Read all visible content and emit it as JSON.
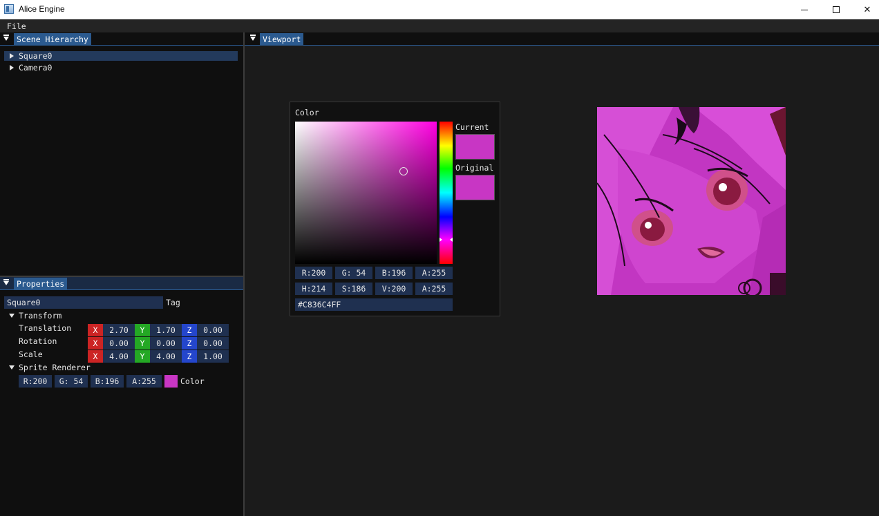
{
  "window": {
    "title": "Alice Engine"
  },
  "menu": {
    "file": "File"
  },
  "hierarchy": {
    "tab": "Scene Hierarchy",
    "items": [
      {
        "label": "Square0",
        "selected": true
      },
      {
        "label": "Camera0",
        "selected": false
      }
    ]
  },
  "properties": {
    "tab": "Properties",
    "name_value": "Square0",
    "tag_label": "Tag",
    "transform": {
      "header": "Transform",
      "rows": [
        {
          "label": "Translation",
          "x": "2.70",
          "y": "1.70",
          "z": "0.00"
        },
        {
          "label": "Rotation",
          "x": "0.00",
          "y": "0.00",
          "z": "0.00"
        },
        {
          "label": "Scale",
          "x": "4.00",
          "y": "4.00",
          "z": "1.00"
        }
      ],
      "axis": {
        "x": "X",
        "y": "Y",
        "z": "Z"
      }
    },
    "sprite_renderer": {
      "header": "Sprite Renderer",
      "r": "R:200",
      "g": "G: 54",
      "b": "B:196",
      "a": "A:255",
      "color_label": "Color",
      "color_hex": "#c836c4"
    }
  },
  "viewport": {
    "tab": "Viewport",
    "background": "#1b1b1b"
  },
  "color_picker": {
    "title": "Color",
    "current_label": "Current",
    "original_label": "Original",
    "current_color": "#c836c4",
    "original_color": "#c836c4",
    "rgba": [
      "R:200",
      "G: 54",
      "B:196",
      "A:255"
    ],
    "hsva": [
      "H:214",
      "S:186",
      "V:200",
      "A:255"
    ],
    "hex": "#C836C4FF"
  },
  "colors": {
    "accent_tab": "#2b5a8f",
    "field_bg": "#1f3050",
    "x_axis": "#cc2424",
    "y_axis": "#24a824",
    "z_axis": "#2446cc"
  },
  "icons": {
    "collapse": "collapse-triangle-icon",
    "tree_expand": "tree-expand-icon",
    "app": "app-window-icon"
  }
}
